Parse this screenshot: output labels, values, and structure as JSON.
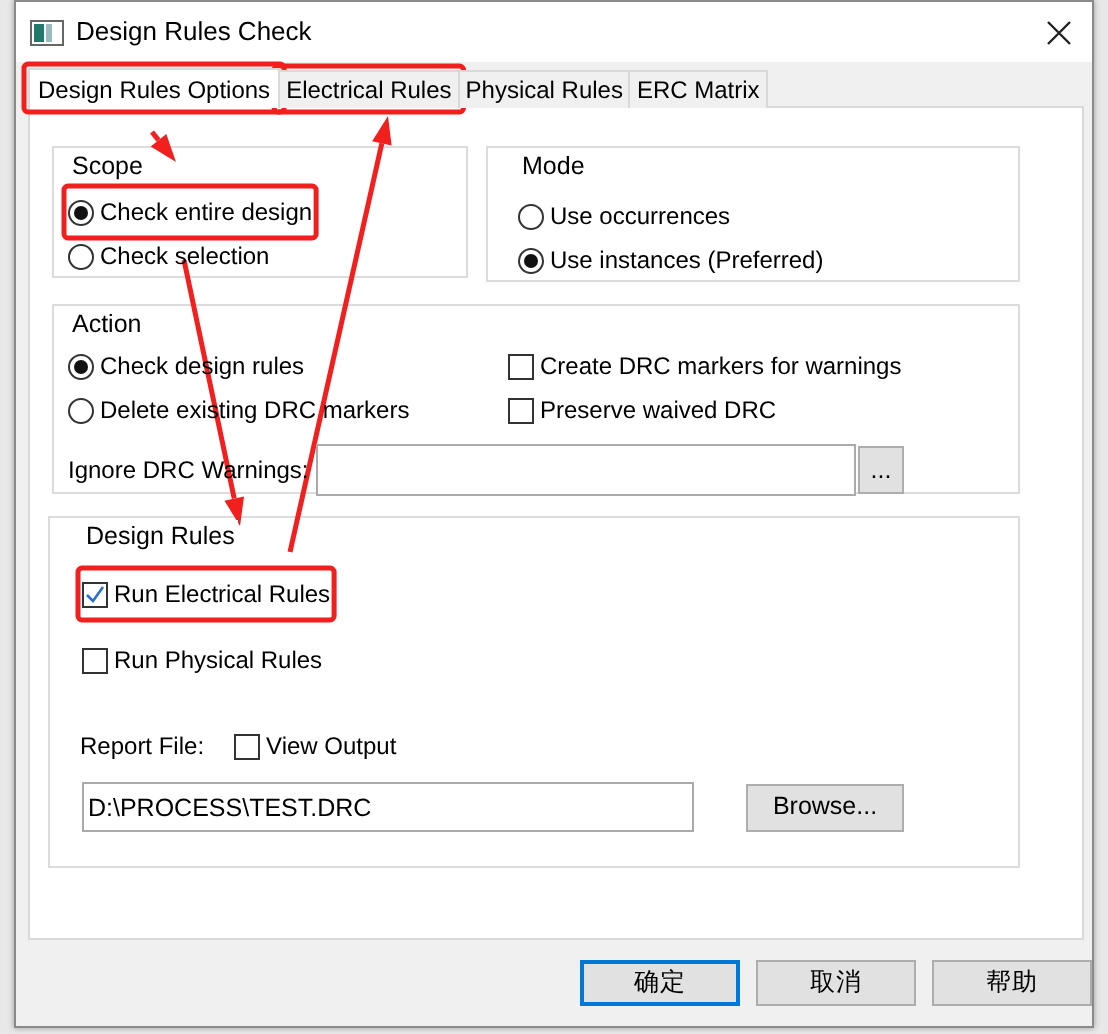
{
  "window": {
    "title": "Design Rules Check"
  },
  "tabs": [
    {
      "label": "Design Rules Options",
      "selected": true,
      "highlighted": true
    },
    {
      "label": "Electrical Rules",
      "selected": false,
      "highlighted": true
    },
    {
      "label": "Physical Rules",
      "selected": false,
      "highlighted": false
    },
    {
      "label": "ERC Matrix",
      "selected": false,
      "highlighted": false
    }
  ],
  "scope": {
    "title": "Scope",
    "options": [
      {
        "label": "Check entire design",
        "selected": true,
        "highlighted": true
      },
      {
        "label": "Check selection",
        "selected": false,
        "highlighted": false
      }
    ]
  },
  "mode": {
    "title": "Mode",
    "options": [
      {
        "label": "Use occurrences",
        "selected": false
      },
      {
        "label": "Use instances (Preferred)",
        "selected": true
      }
    ]
  },
  "action": {
    "title": "Action",
    "options": [
      {
        "label": "Check design rules",
        "selected": true
      },
      {
        "label": "Delete existing DRC markers",
        "selected": false
      }
    ],
    "checkboxes": [
      {
        "label": "Create DRC markers for warnings",
        "checked": false
      },
      {
        "label": "Preserve waived DRC",
        "checked": false
      }
    ],
    "ignore_warnings": {
      "label": "Ignore DRC Warnings:",
      "button": "..."
    }
  },
  "design_rules": {
    "title": "Design Rules",
    "checks": [
      {
        "label": "Run Electrical Rules",
        "checked": true,
        "highlighted": true
      },
      {
        "label": "Run Physical Rules",
        "checked": false,
        "highlighted": false
      }
    ],
    "report_file": {
      "label": "Report File:",
      "view_output": {
        "label": "View Output",
        "checked": false
      },
      "path": "D:\\PROCESS\\TEST.DRC",
      "browse": "Browse..."
    }
  },
  "buttons": [
    {
      "label": "确定",
      "default": true
    },
    {
      "label": "取消",
      "default": false
    },
    {
      "label": "帮助",
      "default": false
    }
  ]
}
